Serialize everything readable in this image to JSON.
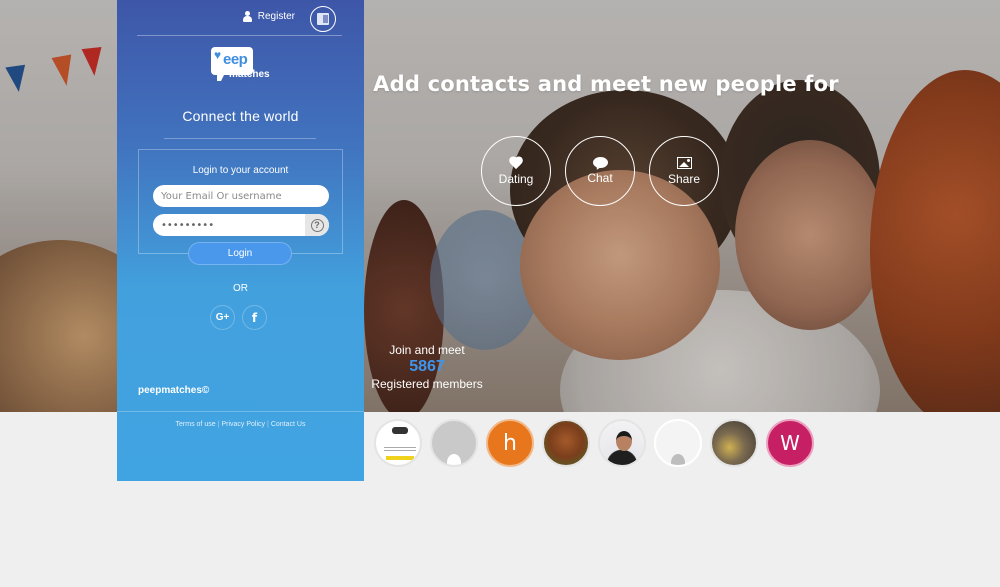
{
  "header": {
    "register_label": "Register",
    "register_icon": "user-icon",
    "language_icon": "translate-icon"
  },
  "logo": {
    "heart": "♥",
    "word_top": "eep",
    "word_bottom": "matches"
  },
  "tagline": "Connect the world",
  "login": {
    "title": "Login to your account",
    "email_placeholder": "Your Email Or username",
    "email_value": "",
    "password_value": "•••••••••",
    "help_icon": "question-circle-icon",
    "help_glyph": "?",
    "login_label": "Login",
    "or_label": "OR",
    "google_label": "G+",
    "facebook_label": "f"
  },
  "footer": {
    "brand": "peepmatches©",
    "links": [
      "Terms of use",
      "Privacy Policy",
      "Contact Us"
    ],
    "separator": "|"
  },
  "hero": {
    "headline": "Add contacts and meet new people for",
    "features": [
      {
        "label": "Dating",
        "icon": "heart-icon"
      },
      {
        "label": "Chat",
        "icon": "chat-bubble-icon"
      },
      {
        "label": "Share",
        "icon": "image-icon"
      }
    ],
    "join_text": "Join and meet",
    "member_count": "5867",
    "members_label": "Registered members"
  },
  "members": [
    {
      "type": "photo",
      "desc": "document-screenshot"
    },
    {
      "type": "default-avatar"
    },
    {
      "type": "letter",
      "letter": "h",
      "color": "#e8761c"
    },
    {
      "type": "photo",
      "desc": "cow"
    },
    {
      "type": "photo",
      "desc": "man-portrait"
    },
    {
      "type": "default-avatar-faded"
    },
    {
      "type": "photo",
      "desc": "group"
    },
    {
      "type": "letter",
      "letter": "W",
      "color": "#c71f63"
    }
  ],
  "colors": {
    "panel_top": "#3e56a8",
    "panel_bottom": "#41a4e2",
    "accent_blue": "#3f95ec",
    "login_button": "#4a98ec",
    "page_bg": "#efefef"
  }
}
